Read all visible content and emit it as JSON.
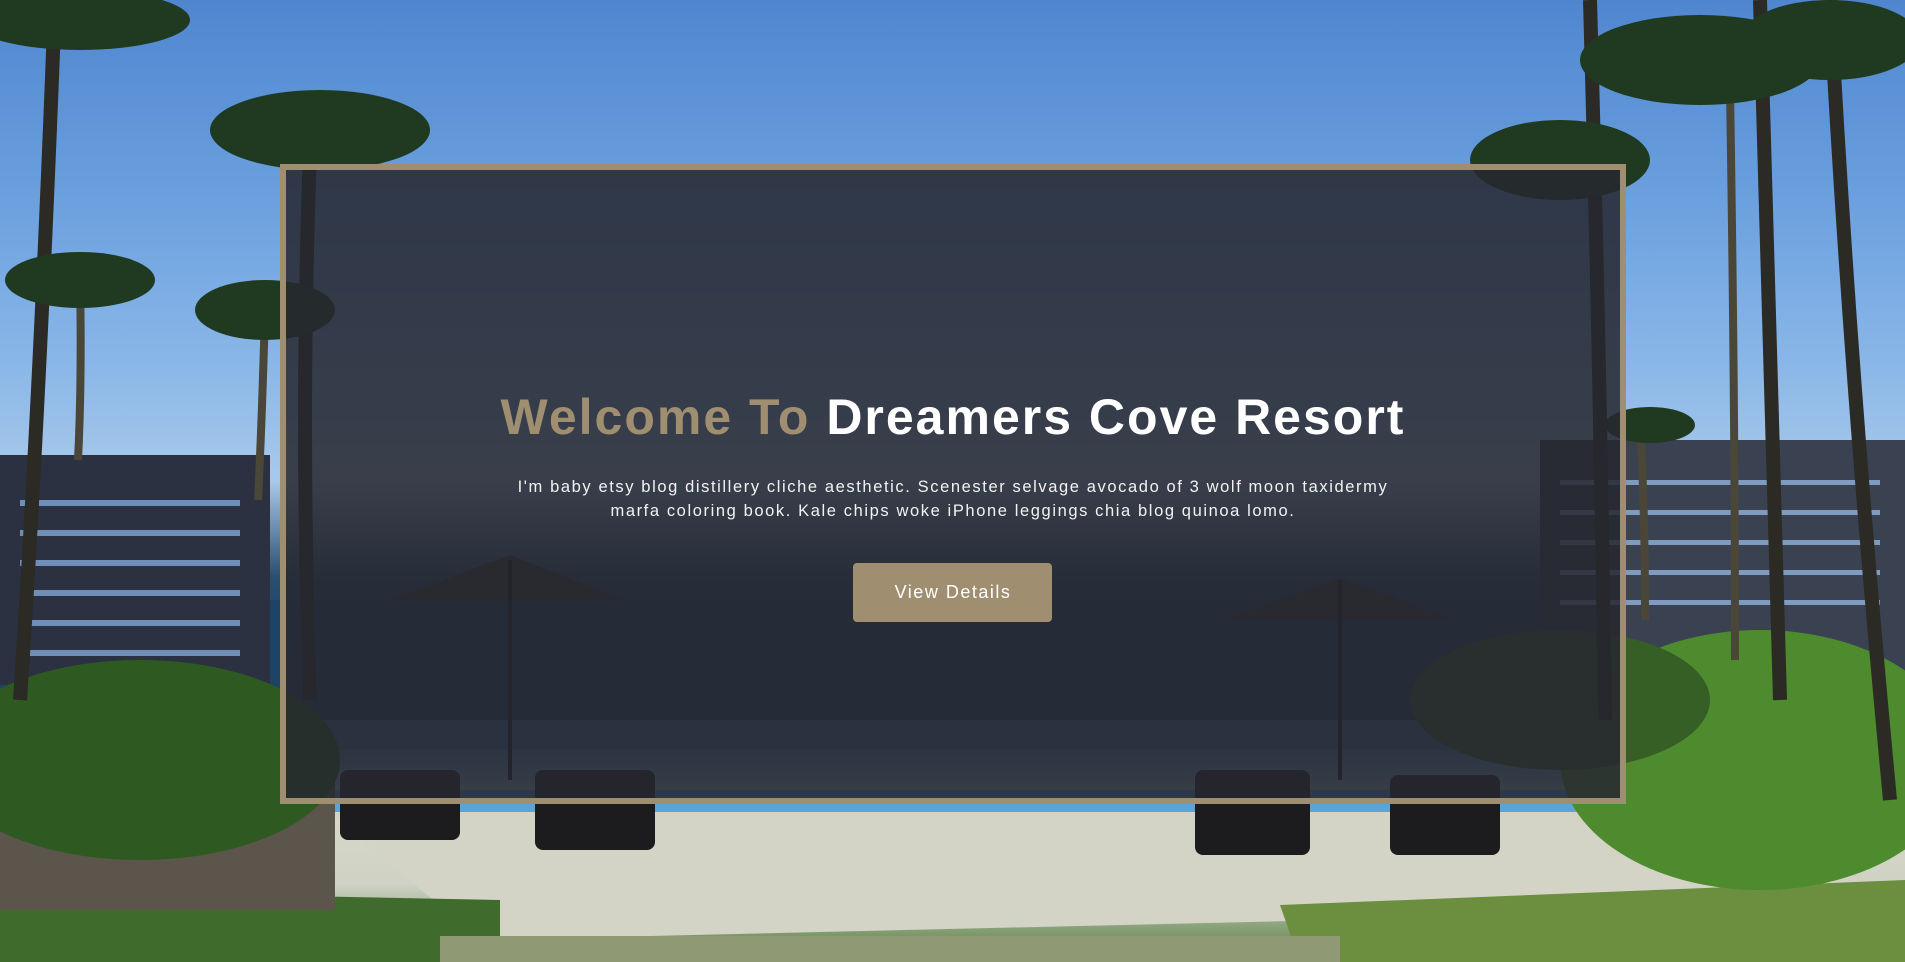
{
  "hero": {
    "title_accent": "Welcome To",
    "title_main": "Dreamers Cove Resort",
    "description": "I'm baby etsy blog distillery cliche aesthetic. Scenester selvage avocado of 3 wolf moon taxidermy marfa coloring book. Kale chips woke iPhone leggings chia blog quinoa lomo.",
    "button_label": "View Details"
  },
  "colors": {
    "accent": "#a08e71",
    "overlay": "#26282f",
    "text": "#ffffff"
  }
}
